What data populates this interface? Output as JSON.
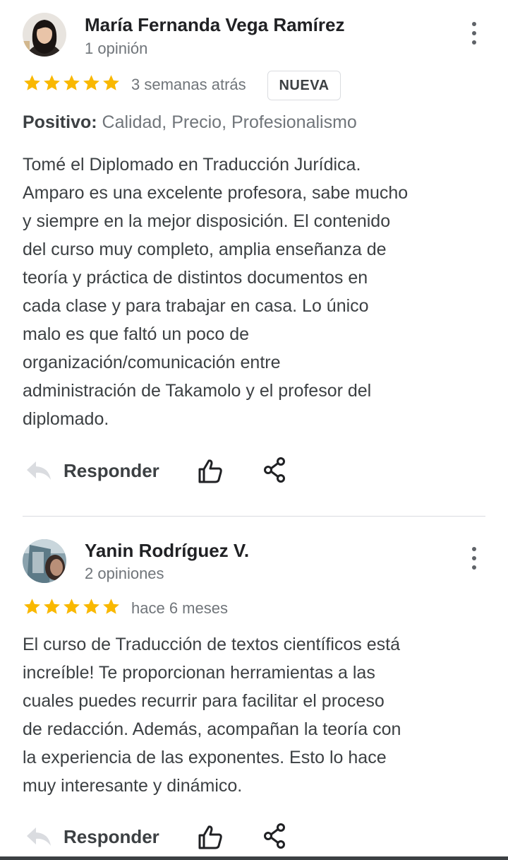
{
  "reviews": [
    {
      "author": "María Fernanda Vega Ramírez",
      "review_count": "1 opinión",
      "rating": 5,
      "date": "3 semanas atrás",
      "badge": "NUEVA",
      "highlights_label": "Positivo:",
      "highlights_value": "Calidad, Precio, Profesionalismo",
      "text_lines": [
        "Tomé el Diplomado en Traducción Jurídica.",
        "Amparo es una excelente profesora, sabe mucho",
        "y siempre en la mejor disposición. El contenido",
        "del curso muy completo, amplia enseñanza de",
        "teoría y práctica de distintos documentos en",
        "cada clase y para trabajar en casa. Lo único",
        "malo es que faltó un poco de",
        "organización/comunicación entre",
        "administración de Takamolo y el profesor del",
        "diplomado."
      ],
      "reply_label": "Responder"
    },
    {
      "author": "Yanin Rodríguez V.",
      "review_count": "2 opiniones",
      "rating": 5,
      "date": "hace 6 meses",
      "text_lines": [
        "El curso de Traducción de textos científicos está",
        "increíble! Te proporcionan herramientas a las",
        "cuales puedes recurrir para facilitar el proceso",
        "de redacción. Además, acompañan la teoría con",
        "la experiencia de las exponentes. Esto lo hace",
        "muy interesante y dinámico."
      ],
      "reply_label": "Responder"
    }
  ],
  "colors": {
    "star": "#f9b800",
    "text": "#3c4043",
    "muted": "#70757a"
  },
  "icons": [
    "avatar",
    "more-vert-icon",
    "star-icon",
    "reply-icon",
    "thumb-up-icon",
    "share-icon"
  ]
}
